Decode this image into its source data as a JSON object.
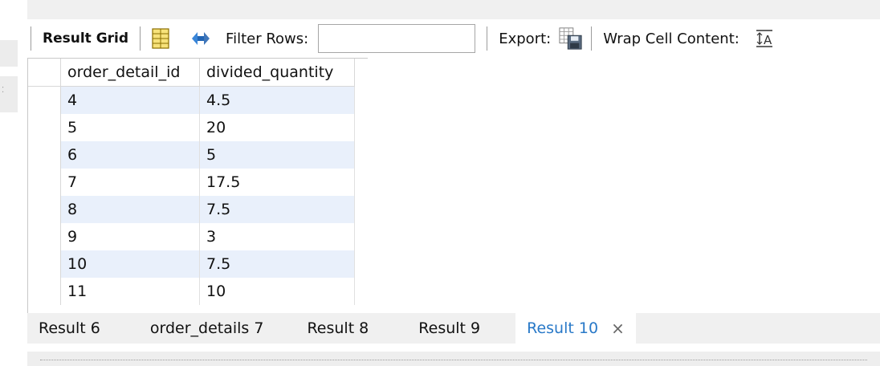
{
  "toolbar": {
    "result_grid_label": "Result Grid",
    "filter_rows_label": "Filter Rows:",
    "filter_rows_value": "",
    "export_label": "Export:",
    "wrap_cell_label": "Wrap Cell Content:"
  },
  "grid": {
    "columns": [
      "order_detail_id",
      "divided_quantity"
    ],
    "rows": [
      [
        "4",
        "4.5"
      ],
      [
        "5",
        "20"
      ],
      [
        "6",
        "5"
      ],
      [
        "7",
        "17.5"
      ],
      [
        "8",
        "7.5"
      ],
      [
        "9",
        "3"
      ],
      [
        "10",
        "7.5"
      ],
      [
        "11",
        "10"
      ]
    ]
  },
  "tabs": [
    {
      "label": "Result 6"
    },
    {
      "label": "order_details 7"
    },
    {
      "label": "Result 8"
    },
    {
      "label": "Result 9"
    },
    {
      "label": "Result 10",
      "active": true,
      "close": "×"
    }
  ],
  "colors": {
    "active_tab": "#2979c8",
    "row_alt": "#e9f0fb"
  }
}
